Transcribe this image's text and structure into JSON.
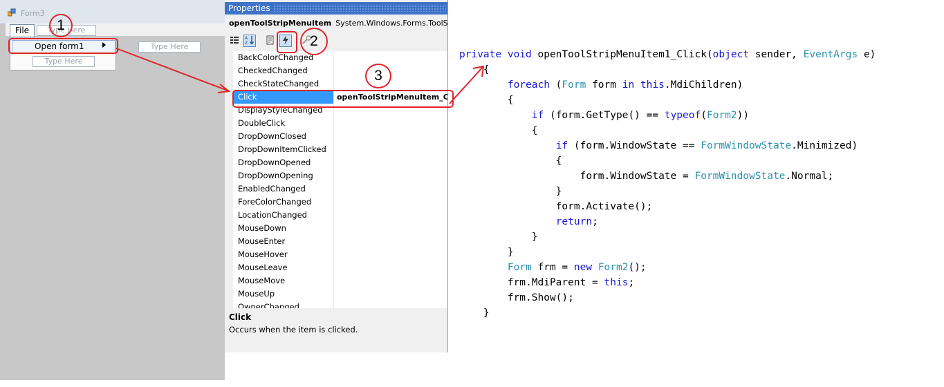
{
  "form": {
    "title": "Form3",
    "menu": {
      "file_label": "File",
      "type_here": "Type Here",
      "open_item_label": "Open form1"
    }
  },
  "properties": {
    "title": "Properties",
    "object_name": "openToolStripMenuItem",
    "object_type": "System.Windows.Forms.ToolStripMenuItem",
    "events": [
      {
        "name": "BackColorChanged",
        "value": ""
      },
      {
        "name": "CheckedChanged",
        "value": ""
      },
      {
        "name": "CheckStateChanged",
        "value": ""
      },
      {
        "name": "Click",
        "value": "openToolStripMenuItem_Click",
        "selected": true
      },
      {
        "name": "DisplayStyleChanged",
        "value": ""
      },
      {
        "name": "DoubleClick",
        "value": ""
      },
      {
        "name": "DropDownClosed",
        "value": ""
      },
      {
        "name": "DropDownItemClicked",
        "value": ""
      },
      {
        "name": "DropDownOpened",
        "value": ""
      },
      {
        "name": "DropDownOpening",
        "value": ""
      },
      {
        "name": "EnabledChanged",
        "value": ""
      },
      {
        "name": "ForeColorChanged",
        "value": ""
      },
      {
        "name": "LocationChanged",
        "value": ""
      },
      {
        "name": "MouseDown",
        "value": ""
      },
      {
        "name": "MouseEnter",
        "value": ""
      },
      {
        "name": "MouseHover",
        "value": ""
      },
      {
        "name": "MouseLeave",
        "value": ""
      },
      {
        "name": "MouseMove",
        "value": ""
      },
      {
        "name": "MouseUp",
        "value": ""
      },
      {
        "name": "OwnerChanged",
        "value": ""
      }
    ],
    "help": {
      "name": "Click",
      "description": "Occurs when the item is clicked."
    },
    "toolbar_icons": [
      "categorized-icon",
      "alphabetical-icon",
      "properties-icon",
      "events-icon",
      "property-pages-icon"
    ]
  },
  "annotations": {
    "step1": "1",
    "step2": "2",
    "step3": "3",
    "color": "#e0242a"
  },
  "code": {
    "lines": [
      [
        {
          "t": "private",
          "c": "kw"
        },
        {
          "t": " "
        },
        {
          "t": "void",
          "c": "kw"
        },
        {
          "t": " openToolStripMenuItem1_Click("
        },
        {
          "t": "object",
          "c": "kw"
        },
        {
          "t": " sender, "
        },
        {
          "t": "EventArgs",
          "c": "ty"
        },
        {
          "t": " e)"
        }
      ],
      [
        {
          "t": "    {"
        }
      ],
      [
        {
          "t": "        "
        },
        {
          "t": "foreach",
          "c": "kw"
        },
        {
          "t": " ("
        },
        {
          "t": "Form",
          "c": "ty"
        },
        {
          "t": " form "
        },
        {
          "t": "in",
          "c": "kw"
        },
        {
          "t": " "
        },
        {
          "t": "this",
          "c": "kw"
        },
        {
          "t": ".MdiChildren)"
        }
      ],
      [
        {
          "t": "        {"
        }
      ],
      [
        {
          "t": "            "
        },
        {
          "t": "if",
          "c": "kw"
        },
        {
          "t": " (form.GetType() == "
        },
        {
          "t": "typeof",
          "c": "kw"
        },
        {
          "t": "("
        },
        {
          "t": "Form2",
          "c": "ty"
        },
        {
          "t": "))"
        }
      ],
      [
        {
          "t": "            {"
        }
      ],
      [
        {
          "t": "                "
        },
        {
          "t": "if",
          "c": "kw"
        },
        {
          "t": " (form.WindowState == "
        },
        {
          "t": "FormWindowState",
          "c": "ty"
        },
        {
          "t": ".Minimized)"
        }
      ],
      [
        {
          "t": "                {"
        }
      ],
      [
        {
          "t": "                    form.WindowState = "
        },
        {
          "t": "FormWindowState",
          "c": "ty"
        },
        {
          "t": ".Normal;"
        }
      ],
      [
        {
          "t": "                }"
        }
      ],
      [
        {
          "t": "                form.Activate();"
        }
      ],
      [
        {
          "t": "                "
        },
        {
          "t": "return",
          "c": "kw"
        },
        {
          "t": ";"
        }
      ],
      [
        {
          "t": "            }"
        }
      ],
      [
        {
          "t": "        }"
        }
      ],
      [
        {
          "t": "        "
        },
        {
          "t": "Form",
          "c": "ty"
        },
        {
          "t": " frm = "
        },
        {
          "t": "new",
          "c": "kw"
        },
        {
          "t": " "
        },
        {
          "t": "Form2",
          "c": "ty"
        },
        {
          "t": "();"
        }
      ],
      [
        {
          "t": "        frm.MdiParent = "
        },
        {
          "t": "this",
          "c": "kw"
        },
        {
          "t": ";"
        }
      ],
      [
        {
          "t": "        frm.Show();"
        }
      ],
      [
        {
          "t": "    }"
        }
      ]
    ]
  }
}
